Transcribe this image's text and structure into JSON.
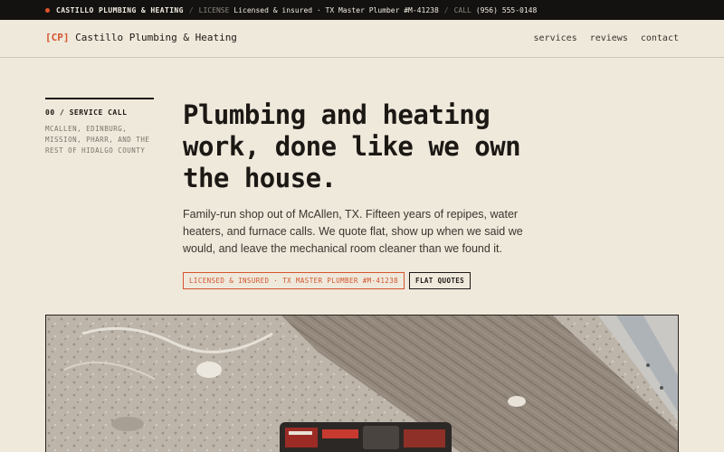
{
  "topbar": {
    "brand": "CASTILLO PLUMBING & HEATING",
    "license_label": "LICENSE",
    "license_value": "Licensed & insured · TX Master Plumber #M-41238",
    "call_label": "CALL",
    "phone": "(956) 555-0148",
    "accent": "#e0552a"
  },
  "header": {
    "logo_mark": "[CP]",
    "logo_name": "Castillo Plumbing & Heating",
    "nav": [
      "services",
      "reviews",
      "contact"
    ]
  },
  "side": {
    "tag": "00 / SERVICE CALL",
    "areas": "MCALLEN, EDINBURG, MISSION, PHARR, AND THE REST OF HIDALGO COUNTY"
  },
  "hero": {
    "title": "Plumbing and heating work, done like we own the house.",
    "copy": "Family-run shop out of McAllen, TX. Fifteen years of repipes, water heaters, and furnace calls. We quote flat, show up when we said we would, and leave the mechanical room cleaner than we found it.",
    "badges": [
      "LICENSED & INSURED · TX MASTER PLUMBER #M-41238",
      "FLAT QUOTES"
    ]
  },
  "colors": {
    "background": "#efe9dc",
    "ink": "#1c1814",
    "accent": "#d4552d"
  },
  "photo": {
    "icon": "jobsite-photo"
  }
}
